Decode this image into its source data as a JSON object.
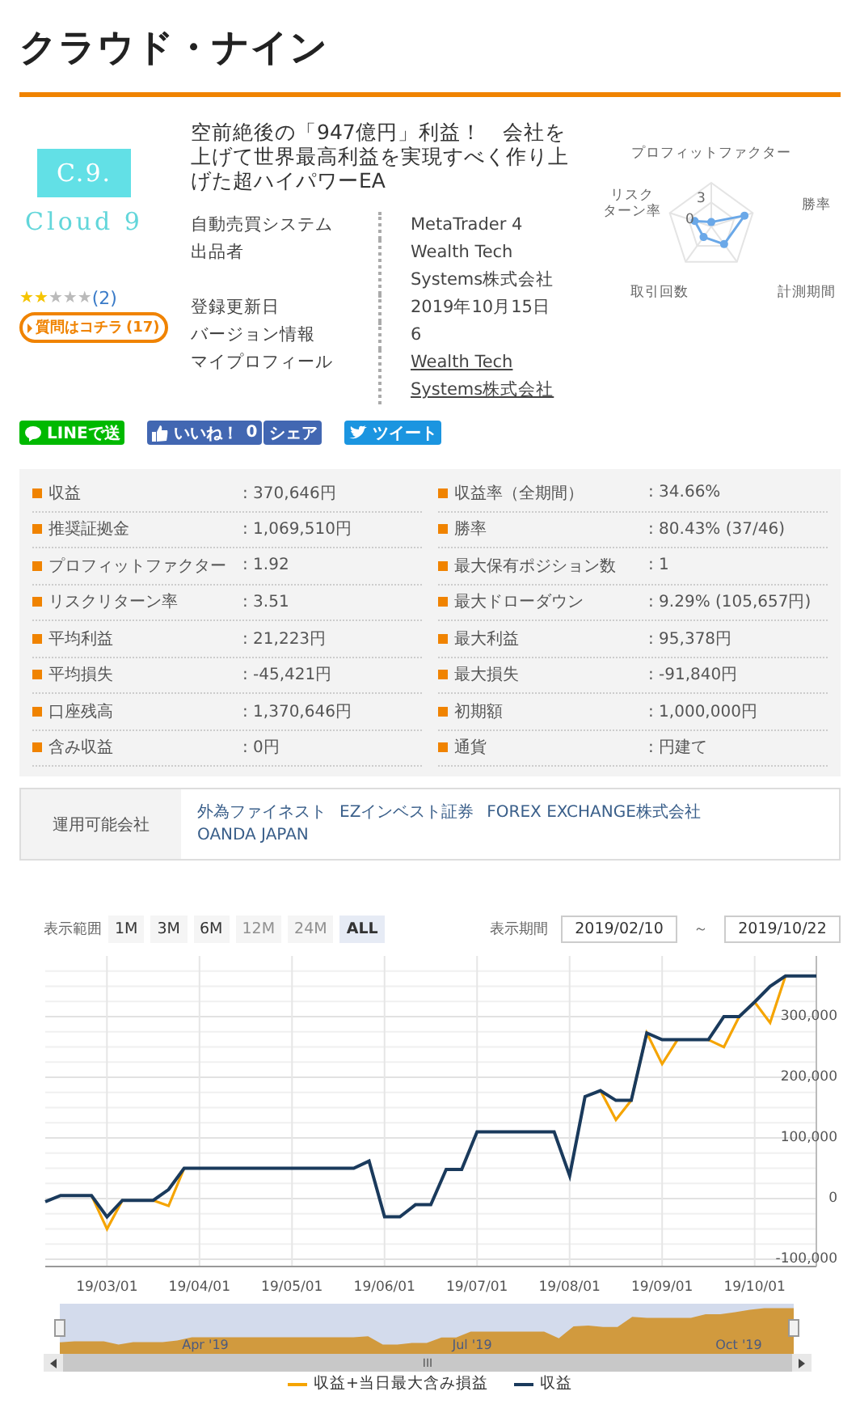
{
  "title": "クラウド・ナイン",
  "product": {
    "logo": {
      "mark": "C.9.",
      "name": "Cloud 9"
    },
    "stars": 2,
    "review_count": "(2)",
    "question": {
      "label": "質問はコチラ",
      "count": "(17)"
    },
    "headline": "空前絶後の「947億円」利益！　会社を上げて世界最高利益を実現すべく作り上げた超ハイパワーEA",
    "info": [
      {
        "label": "自動売買システム",
        "value": "MetaTrader 4",
        "link": false
      },
      {
        "label": "出品者",
        "value": "Wealth Tech Systems株式会社",
        "link": false
      },
      {
        "label": "登録更新日",
        "value": "2019年10月15日",
        "link": false
      },
      {
        "label": "バージョン情報",
        "value": "6",
        "link": false
      },
      {
        "label": "マイプロフィール",
        "value": "Wealth Tech Systems株式会社",
        "link": true
      }
    ],
    "radar": {
      "axes": [
        {
          "lines": [
            "プロフィットファクター"
          ]
        },
        {
          "lines": [
            "リスク",
            "ターン率"
          ]
        },
        {
          "lines": [
            "勝率"
          ]
        },
        {
          "lines": [
            "取引回数"
          ]
        },
        {
          "lines": [
            "計測期間"
          ]
        }
      ],
      "ticks": [
        "3",
        "0"
      ]
    }
  },
  "share": [
    {
      "kind": "line",
      "label": "LINEで送"
    },
    {
      "kind": "like",
      "label": "いいね！",
      "count": "0"
    },
    {
      "kind": "fbshare",
      "label": "シェア"
    },
    {
      "kind": "tweet",
      "label": "ツイート"
    }
  ],
  "stats": [
    {
      "label": "収益",
      "value": ": 370,646円"
    },
    {
      "label": "収益率（全期間）",
      "value": ": 34.66%"
    },
    {
      "label": "推奨証拠金",
      "value": ": 1,069,510円"
    },
    {
      "label": "勝率",
      "value": ": 80.43% (37/46)"
    },
    {
      "label": "プロフィットファクター",
      "value": ": 1.92"
    },
    {
      "label": "最大保有ポジション数",
      "value": ": 1"
    },
    {
      "label": "リスクリターン率",
      "value": ": 3.51"
    },
    {
      "label": "最大ドローダウン",
      "value": ": 9.29% (105,657円)"
    },
    {
      "label": "平均利益",
      "value": ": 21,223円"
    },
    {
      "label": "最大利益",
      "value": ": 95,378円"
    },
    {
      "label": "平均損失",
      "value": ": -45,421円"
    },
    {
      "label": "最大損失",
      "value": ": -91,840円"
    },
    {
      "label": "口座残高",
      "value": ": 1,370,646円"
    },
    {
      "label": "初期額",
      "value": ": 1,000,000円"
    },
    {
      "label": "含み収益",
      "value": ": 0円"
    },
    {
      "label": "通貨",
      "value": ": 円建て"
    }
  ],
  "brokers": {
    "label": "運用可能会社",
    "links": [
      "外為ファイネスト",
      "EZインベスト証券",
      "FOREX EXCHANGE株式会社",
      "OANDA JAPAN"
    ]
  },
  "chart_controls": {
    "range_label": "表示範囲",
    "ranges": [
      {
        "label": "1M",
        "selected": false,
        "disabled": false
      },
      {
        "label": "3M",
        "selected": false,
        "disabled": false
      },
      {
        "label": "6M",
        "selected": false,
        "disabled": false
      },
      {
        "label": "12M",
        "selected": false,
        "disabled": true
      },
      {
        "label": "24M",
        "selected": false,
        "disabled": true
      },
      {
        "label": "ALL",
        "selected": true,
        "disabled": false
      }
    ],
    "period_label": "表示期間",
    "from": "2019/02/10",
    "separator": "～",
    "to": "2019/10/22"
  },
  "chart_data": {
    "type": "line",
    "categories": [
      null,
      null,
      null,
      null,
      "19/03/01",
      null,
      null,
      null,
      null,
      null,
      "19/04/01",
      null,
      null,
      null,
      null,
      null,
      "19/05/01",
      null,
      null,
      null,
      null,
      null,
      "19/06/01",
      null,
      null,
      null,
      null,
      null,
      "19/07/01",
      null,
      null,
      null,
      null,
      null,
      "19/08/01",
      null,
      null,
      null,
      null,
      null,
      "19/09/01",
      null,
      null,
      null,
      null,
      null,
      "19/10/01",
      null,
      null,
      null,
      null
    ],
    "series": [
      {
        "name": "収益+当日最大含み損益",
        "color": "#f5a400",
        "values": [
          null,
          null,
          null,
          5000,
          -50000,
          -3000,
          null,
          -3000,
          -12000,
          50000,
          null,
          null,
          null,
          null,
          null,
          null,
          null,
          null,
          null,
          null,
          null,
          null,
          null,
          null,
          null,
          null,
          null,
          null,
          null,
          null,
          null,
          null,
          null,
          null,
          null,
          null,
          178000,
          130000,
          162000,
          273000,
          222000,
          262000,
          null,
          262000,
          250000,
          300000,
          324000,
          290000,
          367000,
          null,
          null
        ]
      },
      {
        "name": "収益",
        "color": "#1a3a5c",
        "values": [
          -5000,
          5000,
          5000,
          5000,
          -30000,
          -3000,
          -3000,
          -3000,
          15000,
          50000,
          50000,
          50000,
          50000,
          50000,
          50000,
          50000,
          50000,
          50000,
          50000,
          50000,
          50000,
          62000,
          -30000,
          -30000,
          -10000,
          -10000,
          48000,
          48000,
          110000,
          110000,
          110000,
          110000,
          110000,
          110000,
          38000,
          168000,
          178000,
          162000,
          162000,
          273000,
          262000,
          262000,
          262000,
          262000,
          300000,
          300000,
          324000,
          350000,
          367000,
          367000,
          367000
        ]
      }
    ],
    "ylim": [
      -112000,
      400000
    ],
    "grid": true,
    "yticks": [
      {
        "value": -100000,
        "label": "-100,000"
      },
      {
        "value": 0,
        "label": "0"
      },
      {
        "value": 100000,
        "label": "100,000"
      },
      {
        "value": 200000,
        "label": "200,000"
      },
      {
        "value": 300000,
        "label": "300,000"
      }
    ]
  },
  "navigator": {
    "labels": [
      "Apr '19",
      "Jul '19",
      "Oct '19"
    ],
    "scroll_grip": "III"
  }
}
